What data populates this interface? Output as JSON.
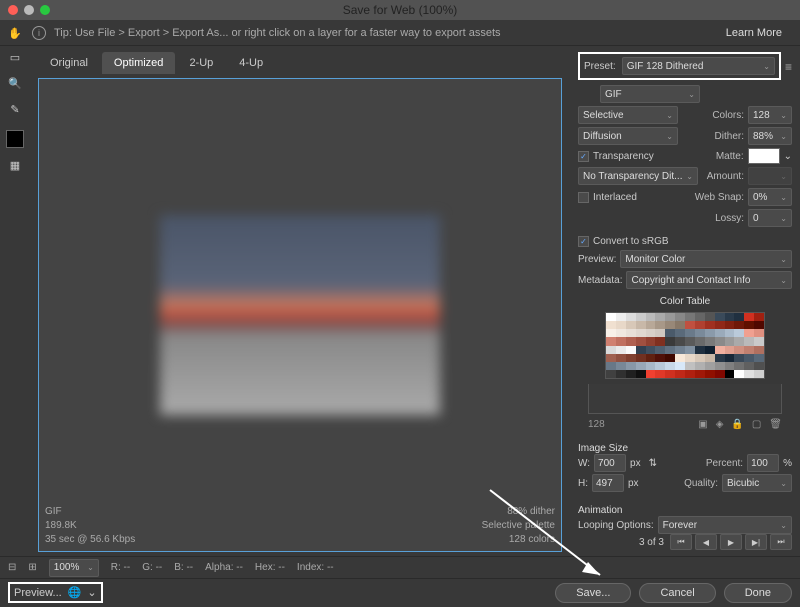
{
  "window": {
    "title": "Save for Web (100%)"
  },
  "tipbar": {
    "text": "Tip: Use File > Export > Export As...  or right click on a layer for a faster way to export assets",
    "learn_more": "Learn More"
  },
  "tabs": {
    "original": "Original",
    "optimized": "Optimized",
    "two_up": "2-Up",
    "four_up": "4-Up"
  },
  "preview_meta": {
    "format": "GIF",
    "size": "189.8K",
    "timing": "35 sec @ 56.6 Kbps",
    "dither": "88% dither",
    "palette": "Selective palette",
    "colors": "128 colors"
  },
  "preset": {
    "label": "Preset:",
    "value": "GIF 128 Dithered"
  },
  "format": {
    "value": "GIF"
  },
  "reduction": {
    "value": "Selective",
    "colors_label": "Colors:",
    "colors_value": "128"
  },
  "dither": {
    "method": "Diffusion",
    "label": "Dither:",
    "value": "88%"
  },
  "transparency": {
    "label": "Transparency",
    "matte_label": "Matte:"
  },
  "transp_dither": {
    "value": "No Transparency Dit...",
    "amount_label": "Amount:"
  },
  "interlaced": {
    "label": "Interlaced",
    "websnap_label": "Web Snap:",
    "websnap_value": "0%"
  },
  "lossy": {
    "label": "Lossy:",
    "value": "0"
  },
  "srgb": {
    "label": "Convert to sRGB"
  },
  "preview_profile": {
    "label": "Preview:",
    "value": "Monitor Color"
  },
  "metadata": {
    "label": "Metadata:",
    "value": "Copyright and Contact Info"
  },
  "color_table": {
    "title": "Color Table",
    "count": "128"
  },
  "image_size": {
    "title": "Image Size",
    "w_label": "W:",
    "w_value": "700",
    "px": "px",
    "h_label": "H:",
    "h_value": "497",
    "percent_label": "Percent:",
    "percent_value": "100",
    "pct": "%",
    "quality_label": "Quality:",
    "quality_value": "Bicubic"
  },
  "animation": {
    "title": "Animation",
    "looping_label": "Looping Options:",
    "looping_value": "Forever",
    "frame": "3 of 3"
  },
  "statusbar": {
    "zoom": "100%",
    "r": "R: --",
    "g": "G: --",
    "b": "B: --",
    "alpha": "Alpha: --",
    "hex": "Hex: --",
    "index": "Index: --"
  },
  "footer": {
    "preview": "Preview...",
    "save": "Save...",
    "cancel": "Cancel",
    "done": "Done"
  },
  "color_table_colors": [
    "#fff",
    "#eee",
    "#ddd",
    "#ccc",
    "#bbb",
    "#aaa",
    "#999",
    "#888",
    "#777",
    "#666",
    "#555",
    "#3a4a5a",
    "#2a3a4a",
    "#203040",
    "#d03020",
    "#a02010",
    "#f0e0d0",
    "#e8d8c8",
    "#d8c8b8",
    "#c8b8a8",
    "#b8a898",
    "#a89888",
    "#988878",
    "#887868",
    "#c05040",
    "#b04030",
    "#a03020",
    "#902818",
    "#802010",
    "#701808",
    "#601000",
    "#500800",
    "#f8f0e8",
    "#f0e8e0",
    "#e8e0d8",
    "#e0d8d0",
    "#d8d0c8",
    "#d0c8c0",
    "#4a5a6a",
    "#5a6a7a",
    "#6a7a8a",
    "#7a8a9a",
    "#8a9aaa",
    "#9aaaba",
    "#aabacA",
    "#bacada",
    "#f0a090",
    "#e09080",
    "#d08070",
    "#c07060",
    "#b06050",
    "#a05040",
    "#904030",
    "#803020",
    "#3a3a3a",
    "#4a4a4a",
    "#5a5a5a",
    "#6a6a6a",
    "#7a7a7a",
    "#8a8a8a",
    "#9a9a9a",
    "#aaaaaa",
    "#bababa",
    "#cacaca",
    "#dadada",
    "#eaeaea",
    "#fafafa",
    "#304050",
    "#405060",
    "#506070",
    "#607080",
    "#708090",
    "#8090a0",
    "#203040",
    "#102030",
    "#f0b0a0",
    "#e0a090",
    "#d09080",
    "#c08070",
    "#b07060",
    "#a06050",
    "#905040",
    "#804030",
    "#703020",
    "#602010",
    "#501008",
    "#400800",
    "#f8e8d8",
    "#e8d8c8",
    "#d8c8b8",
    "#c8b8a8",
    "#283848",
    "#182838",
    "#384858",
    "#485868",
    "#586878",
    "#687888",
    "#788898",
    "#8898a8",
    "#98a8b8",
    "#a8b8c8",
    "#b8c8d8",
    "#c8d8e8",
    "#d8e8f8",
    "#c0c0c0",
    "#b0b0b0",
    "#a0a0a0",
    "#909090",
    "#808080",
    "#707070",
    "#606060",
    "#505050",
    "#404040",
    "#303030",
    "#202020",
    "#101010",
    "#f04030",
    "#e03828",
    "#d03020",
    "#c02818",
    "#b02010",
    "#a01808",
    "#901000",
    "#800800",
    "#000000",
    "#ffffff",
    "#e0e0e0",
    "#d0d0d0"
  ]
}
